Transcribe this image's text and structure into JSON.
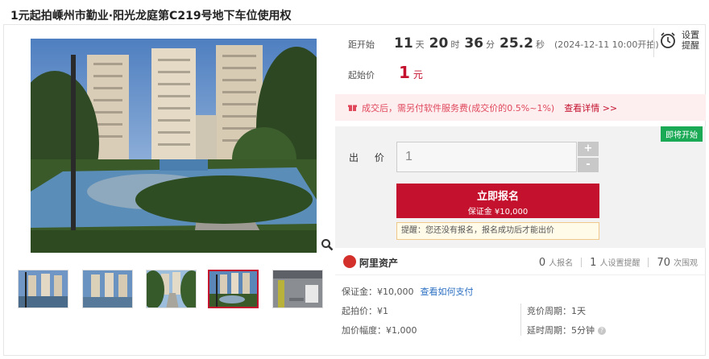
{
  "title": "1元起拍嵊州市勤业·阳光龙庭第C219号地下车位使用权",
  "countdown": {
    "label": "距开始",
    "days": "11",
    "days_unit": "天",
    "hours": "20",
    "hours_unit": "时",
    "minutes": "36",
    "minutes_unit": "分",
    "seconds": "25.2",
    "seconds_unit": "秒",
    "start_date": "(2024-12-11 10:00开拍)"
  },
  "remind": {
    "label_line1": "设置",
    "label_line2": "提醒",
    "icon": "alarm-clock-icon"
  },
  "start_price": {
    "label": "起始价",
    "value": "1",
    "unit": "元"
  },
  "notice": {
    "text": "成交后，需另付软件服务费(成交价的0.5%~1%)",
    "link": "查看详情 >>"
  },
  "bid": {
    "badge": "即将开始",
    "label": "出 价",
    "input_value": "1",
    "plus": "+",
    "minus": "-",
    "register_label": "立即报名",
    "deposit_label": "保证金 ¥10,000",
    "tip": "提醒：您还没有报名，报名成功后才能出价"
  },
  "platform": {
    "name": "阿里资产",
    "signups": "0",
    "signups_label": "人报名",
    "reminders": "1",
    "reminders_label": "人设置提醒",
    "views": "70",
    "views_label": "次围观"
  },
  "details": {
    "deposit": "保证金：¥10,000",
    "payment_link": "查看如何支付",
    "start_price": "起拍价：¥1",
    "increment": "加价幅度：¥1,000",
    "cycle": "竞价周期：1天",
    "extension": "延时周期：5分钟"
  },
  "colors": {
    "accent": "#c4122e",
    "badge": "#1aaa55",
    "link": "#2b6fc2"
  }
}
